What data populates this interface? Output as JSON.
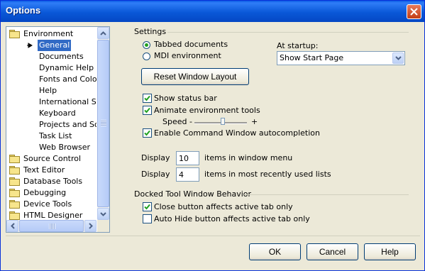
{
  "window": {
    "title": "Options",
    "close_glyph": "✕"
  },
  "tree": {
    "items": [
      {
        "label": "Environment",
        "icon": "folder-icon"
      },
      {
        "label": "General",
        "selected": true,
        "icon": "arrow-icon"
      },
      {
        "label": "Documents"
      },
      {
        "label": "Dynamic Help"
      },
      {
        "label": "Fonts and Colors"
      },
      {
        "label": "Help"
      },
      {
        "label": "International Settings"
      },
      {
        "label": "Keyboard"
      },
      {
        "label": "Projects and Solutions"
      },
      {
        "label": "Task List"
      },
      {
        "label": "Web Browser"
      },
      {
        "label": "Source Control",
        "icon": "folder-icon"
      },
      {
        "label": "Text Editor",
        "icon": "folder-icon"
      },
      {
        "label": "Database Tools",
        "icon": "folder-icon"
      },
      {
        "label": "Debugging",
        "icon": "folder-icon"
      },
      {
        "label": "Device Tools",
        "icon": "folder-icon"
      },
      {
        "label": "HTML Designer",
        "icon": "folder-icon"
      }
    ]
  },
  "settings": {
    "group_label": "Settings",
    "tabbed_documents": {
      "label": "Tabbed documents",
      "checked": true
    },
    "mdi_environment": {
      "label": "MDI environment",
      "checked": false
    },
    "at_startup_label": "At startup:",
    "startup_value": "Show Start Page",
    "reset_layout_label": "Reset Window Layout",
    "show_status_bar": {
      "label": "Show status bar",
      "checked": true
    },
    "animate_tools": {
      "label": "Animate environment tools",
      "checked": true
    },
    "speed_label": "Speed -",
    "speed_plus": "+",
    "speed_level": 0.55,
    "command_autocompletion": {
      "label": "Enable Command Window autocompletion",
      "checked": true
    },
    "display_label_1": "Display",
    "window_menu_items": "10",
    "window_menu_suffix": "items in window menu",
    "display_label_2": "Display",
    "mru_items": "4",
    "mru_suffix": "items in most recently used lists"
  },
  "docked": {
    "group_label": "Docked Tool Window Behavior",
    "close_button": {
      "label": "Close button affects active tab only",
      "checked": true
    },
    "auto_hide": {
      "label": "Auto Hide button affects active tab only",
      "checked": false
    }
  },
  "buttons": {
    "ok": "OK",
    "cancel": "Cancel",
    "help": "Help"
  },
  "colors": {
    "title_bar": "#0a5be4",
    "selection": "#316ac5",
    "dialog_bg": "#ece9d8",
    "radio_dot": "#21a121"
  }
}
